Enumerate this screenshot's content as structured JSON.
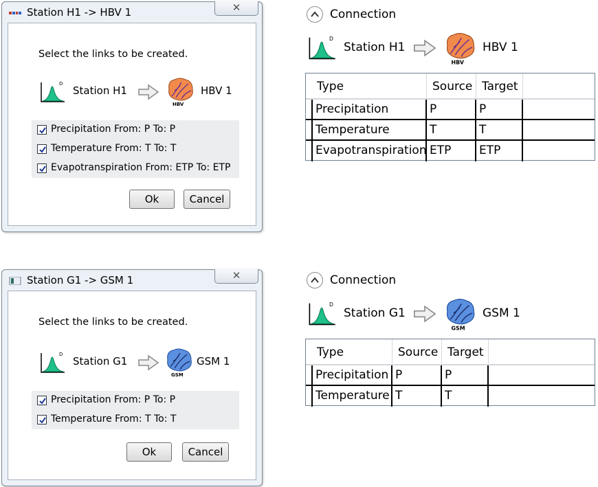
{
  "dialogs": [
    {
      "title": "Station H1 -> HBV 1",
      "close_label": "✕",
      "instruction": "Select the links to be created.",
      "station": "Station H1",
      "model": "HBV 1",
      "model_icon": "hbv-model-icon",
      "model_badge": "HBV",
      "links": [
        {
          "label": "Precipitation  From: P  To: P",
          "checked": true
        },
        {
          "label": "Temperature  From: T  To: T",
          "checked": true
        },
        {
          "label": "Evapotranspiration  From: ETP  To: ETP",
          "checked": true
        }
      ],
      "ok_label": "Ok",
      "cancel_label": "Cancel"
    },
    {
      "title": "Station G1 -> GSM 1",
      "close_label": "✕",
      "instruction": "Select the links to be created.",
      "station": "Station G1",
      "model": "GSM 1",
      "model_icon": "gsm-model-icon",
      "model_badge": "GSM",
      "links": [
        {
          "label": "Precipitation  From: P  To: P",
          "checked": true
        },
        {
          "label": "Temperature  From: T  To: T",
          "checked": true
        }
      ],
      "ok_label": "Ok",
      "cancel_label": "Cancel"
    }
  ],
  "connections": [
    {
      "title": "Connection",
      "station": "Station H1",
      "model": "HBV 1",
      "model_badge": "HBV",
      "columns": [
        "Type",
        "Source",
        "Target"
      ],
      "rows": [
        [
          "Precipitation",
          "P",
          "P"
        ],
        [
          "Temperature",
          "T",
          "T"
        ],
        [
          "Evapotranspiration",
          "ETP",
          "ETP"
        ]
      ]
    },
    {
      "title": "Connection",
      "station": "Station G1",
      "model": "GSM 1",
      "model_badge": "GSM",
      "columns": [
        "Type",
        "Source",
        "Target"
      ],
      "rows": [
        [
          "Precipitation",
          "P",
          "P"
        ],
        [
          "Temperature",
          "T",
          "T"
        ]
      ]
    }
  ],
  "colors": {
    "hbv_fill": "#f28a4c",
    "gsm_fill": "#5b8fe0",
    "station_curve": "#1fc08a"
  },
  "icons": {
    "station": "distribution-curve-icon",
    "arrow": "right-arrow-icon",
    "expander": "chevron-up-icon",
    "checkbox": "checkmark-icon"
  }
}
